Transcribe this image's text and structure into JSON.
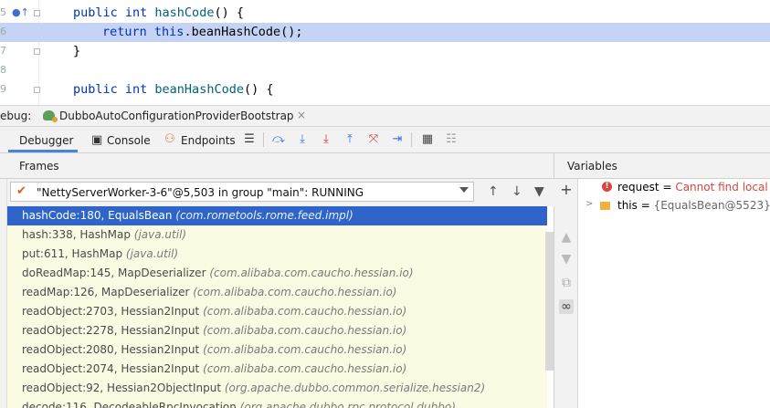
{
  "editor": {
    "lines": [
      {
        "num": "5",
        "text_kw": "public int",
        "text_fn": "hashCode",
        "text_rest": "() {"
      },
      {
        "num": "6",
        "text_kw": "return",
        "text_this": "this",
        "text_rest": ".beanHashCode();"
      },
      {
        "num": "7",
        "text_rest": "}"
      },
      {
        "num": "8",
        "text_rest": ""
      },
      {
        "num": "9",
        "text_kw": "public int",
        "text_fn": "beanHashCode",
        "text_rest": "() {"
      }
    ]
  },
  "debug_bar": {
    "label": "ebug:",
    "config_name": "DubboAutoConfigurationProviderBootstrap",
    "close": "×"
  },
  "toolbar": {
    "tabs": [
      {
        "label": "Debugger"
      },
      {
        "label": "Console"
      },
      {
        "label": "Endpoints"
      }
    ]
  },
  "frames": {
    "title": "Frames",
    "thread": "\"NettyServerWorker-3-6\"@5,503 in group \"main\": RUNNING",
    "items": [
      {
        "method": "hashCode:180, EqualsBean",
        "pkg": "(com.rometools.rome.feed.impl)"
      },
      {
        "method": "hash:338, HashMap",
        "pkg": "(java.util)"
      },
      {
        "method": "put:611, HashMap",
        "pkg": "(java.util)"
      },
      {
        "method": "doReadMap:145, MapDeserializer",
        "pkg": "(com.alibaba.com.caucho.hessian.io)"
      },
      {
        "method": "readMap:126, MapDeserializer",
        "pkg": "(com.alibaba.com.caucho.hessian.io)"
      },
      {
        "method": "readObject:2703, Hessian2Input",
        "pkg": "(com.alibaba.com.caucho.hessian.io)"
      },
      {
        "method": "readObject:2278, Hessian2Input",
        "pkg": "(com.alibaba.com.caucho.hessian.io)"
      },
      {
        "method": "readObject:2080, Hessian2Input",
        "pkg": "(com.alibaba.com.caucho.hessian.io)"
      },
      {
        "method": "readObject:2074, Hessian2Input",
        "pkg": "(com.alibaba.com.caucho.hessian.io)"
      },
      {
        "method": "readObject:92, Hessian2ObjectInput",
        "pkg": "(org.apache.dubbo.common.serialize.hessian2)"
      },
      {
        "method": "decode:116, DecodeableRpcInvocation",
        "pkg": "(org.apache.dubbo.rpc.protocol.dubbo)"
      }
    ]
  },
  "variables": {
    "title": "Variables",
    "items": [
      {
        "name": "request",
        "eq": " = ",
        "value": "Cannot find local v"
      },
      {
        "name": "this",
        "eq": " = ",
        "value": "{EqualsBean@5523}"
      }
    ]
  },
  "colors": {
    "selection": "#2f65ca",
    "frame_bg": "#fbfbe4",
    "error": "#d64541",
    "highlight_line": "#c5d4f4"
  }
}
